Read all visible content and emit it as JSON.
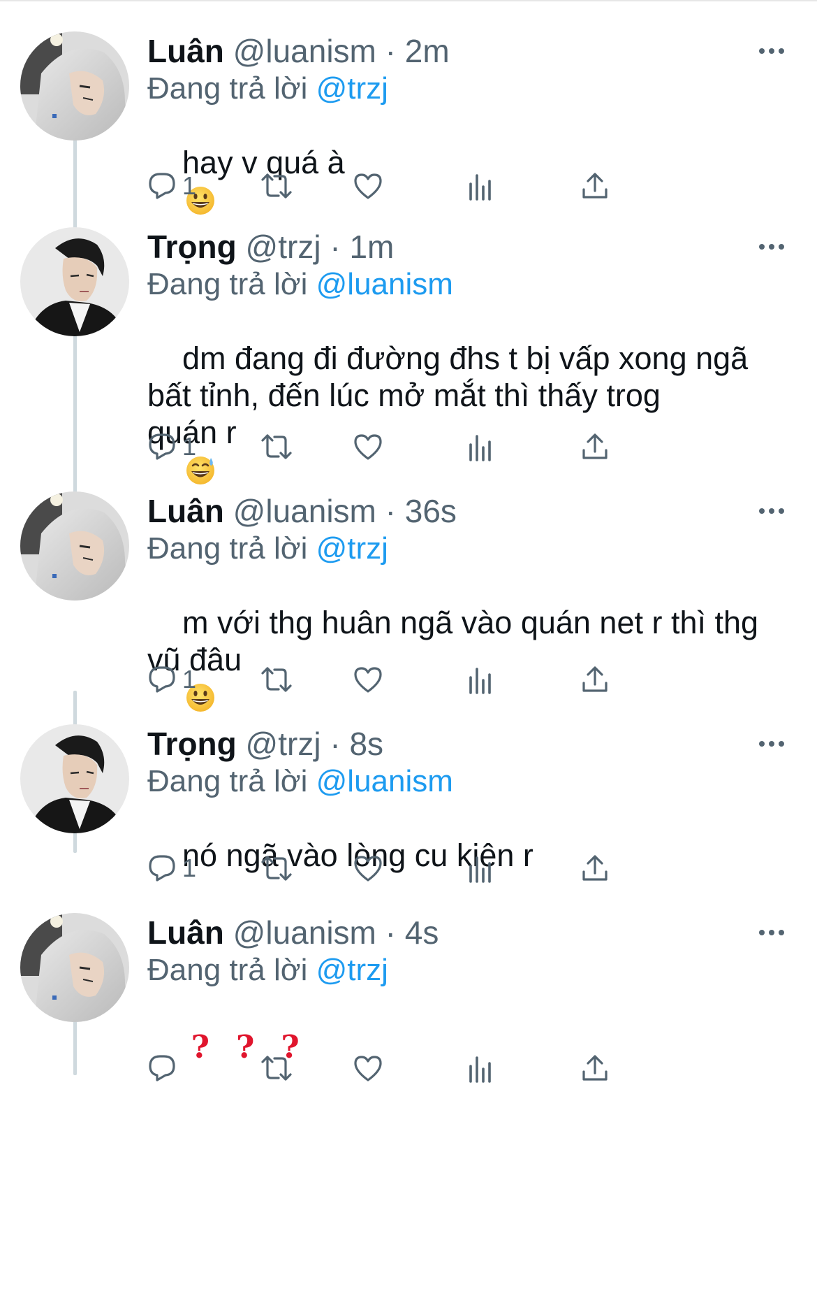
{
  "colors": {
    "link": "#1d9bf0",
    "secondary_text": "#536471",
    "thread_line": "#cfd9de",
    "question_marks": "#e0152d"
  },
  "reply_prefix": "Đang trả lời",
  "tweets": [
    {
      "name": "Luân",
      "handle": "@luanism",
      "separator": "·",
      "time": "2m",
      "reply_to": "@trzj",
      "text": "hay v quá à",
      "emoji": "grinning-face",
      "reply_count": "1"
    },
    {
      "name": "Trọng",
      "handle": "@trzj",
      "separator": "·",
      "time": "1m",
      "reply_to": "@luanism",
      "text": "dm đang đi đường đhs t bị vấp xong ngã\nbất tỉnh, đến lúc mở mắt thì thấy trog\nquán r",
      "emoji": "grinning-face-with-sweat",
      "reply_count": "1"
    },
    {
      "name": "Luân",
      "handle": "@luanism",
      "separator": "·",
      "time": "36s",
      "reply_to": "@trzj",
      "text": "m với thg huân ngã vào quán net r thì thg\nvũ đâu",
      "emoji": "grinning-face",
      "reply_count": "1"
    },
    {
      "name": "Trọng",
      "handle": "@trzj",
      "separator": "·",
      "time": "8s",
      "reply_to": "@luanism",
      "text": "nó ngã vào lòng cu kiên r",
      "emoji": "",
      "reply_count": "1"
    },
    {
      "name": "Luân",
      "handle": "@luanism",
      "separator": "·",
      "time": "4s",
      "reply_to": "@trzj",
      "text": "",
      "question_marks": [
        "?",
        "?",
        "?"
      ],
      "emoji": "",
      "reply_count": ""
    }
  ],
  "icons": {
    "reply": "speech-bubble-icon",
    "retweet": "retweet-arrows-icon",
    "like": "heart-icon",
    "analytics": "bar-chart-icon",
    "share": "share-upload-icon",
    "more": "more-dots-icon"
  }
}
